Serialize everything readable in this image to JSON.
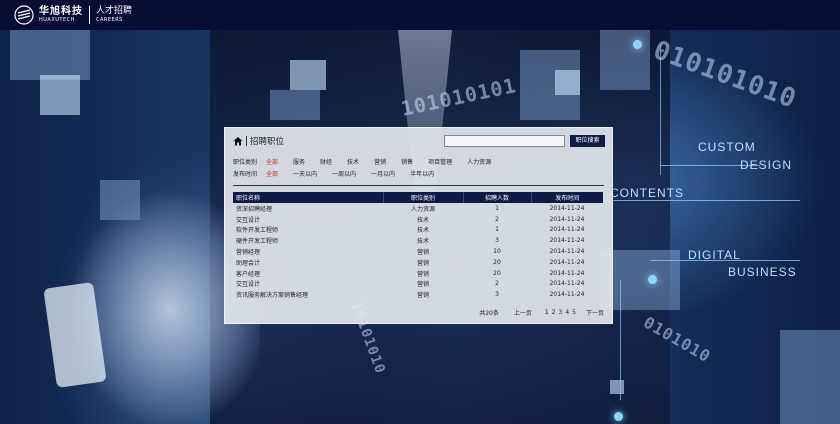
{
  "header": {
    "company_cn": "华旭科技",
    "company_en": "HUAXUTECH",
    "careers_cn": "人才招聘",
    "careers_en": "CAREERS"
  },
  "background": {
    "binary_top": "101010101",
    "binary_right": "010101010",
    "binary_mid": "10101010",
    "binary_low": "0101010",
    "labels": [
      "CUSTOM",
      "DESIGN",
      "CONTENTS",
      "DIGITAL",
      "BUSINESS"
    ]
  },
  "panel": {
    "title": "招聘职位",
    "search": {
      "value": "",
      "button_label": "职位搜索"
    },
    "category_filter": {
      "label": "职位类别",
      "options": [
        "全部",
        "服务",
        "财经",
        "技术",
        "营销",
        "销售",
        "项目管理",
        "人力资源"
      ],
      "selected": "全部"
    },
    "time_filter": {
      "label": "发布时间",
      "options": [
        "全部",
        "一天以内",
        "一周以内",
        "一月以内",
        "半年以内"
      ],
      "selected": "全部"
    },
    "table": {
      "columns": [
        "职位名称",
        "职位类别",
        "招聘人数",
        "发布时间"
      ],
      "rows": [
        [
          "资深招聘经理",
          "人力资源",
          "1",
          "2014-11-24"
        ],
        [
          "交互设计",
          "技术",
          "2",
          "2014-11-24"
        ],
        [
          "软件开发工程师",
          "技术",
          "1",
          "2014-11-24"
        ],
        [
          "硬件开发工程师",
          "技术",
          "3",
          "2014-11-24"
        ],
        [
          "营销经理",
          "营销",
          "10",
          "2014-11-24"
        ],
        [
          "助理会计",
          "营销",
          "20",
          "2014-11-24"
        ],
        [
          "客户经理",
          "营销",
          "20",
          "2014-11-24"
        ],
        [
          "交互设计",
          "营销",
          "2",
          "2014-11-24"
        ],
        [
          "资讯服务解决方案销售经理",
          "营销",
          "3",
          "2014-11-24"
        ]
      ]
    },
    "pager": {
      "total": "共20条",
      "prev": "上一页",
      "pages": [
        "1",
        "2",
        "3",
        "4",
        "5"
      ],
      "next": "下一页"
    }
  },
  "colors": {
    "header_bg": "#070d35",
    "accent_red": "#c0302a",
    "table_head": "#0d1a45"
  }
}
